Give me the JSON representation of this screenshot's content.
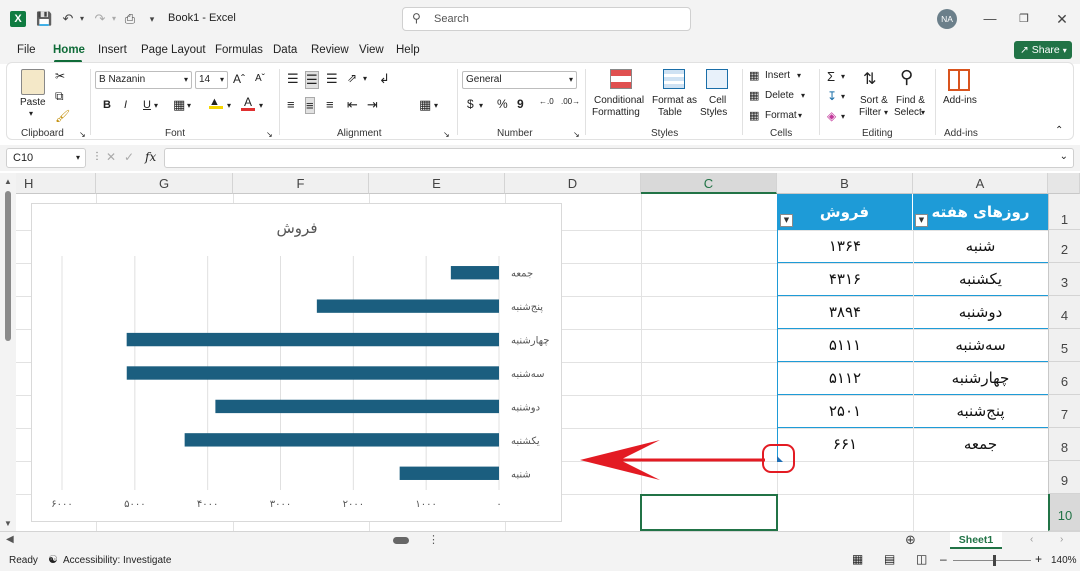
{
  "titlebar": {
    "book_title": "Book1 - Excel",
    "search_placeholder": "Search",
    "user_initials": "NA",
    "share_label": "Share"
  },
  "tabs": [
    "File",
    "Home",
    "Insert",
    "Page Layout",
    "Formulas",
    "Data",
    "Review",
    "View",
    "Help"
  ],
  "ribbon": {
    "clipboard": {
      "paste": "Paste",
      "label": "Clipboard"
    },
    "font": {
      "name": "B Nazanin",
      "size": "14",
      "label": "Font",
      "bold": "B",
      "italic": "I",
      "underline": "U"
    },
    "alignment": {
      "label": "Alignment"
    },
    "number": {
      "format": "General",
      "label": "Number",
      "currency": "$",
      "percent": "%",
      "comma": "9"
    },
    "styles": {
      "conditional": "Conditional",
      "formatting": "Formatting",
      "format_as": "Format as",
      "table": "Table",
      "cell": "Cell",
      "cell_styles": "Styles",
      "label": "Styles"
    },
    "cells": {
      "insert": "Insert",
      "delete": "Delete",
      "format": "Format",
      "label": "Cells"
    },
    "editing": {
      "sort": "Sort &",
      "filter": "Filter",
      "find": "Find &",
      "select": "Select",
      "label": "Editing"
    },
    "addins": {
      "button": "Add-ins",
      "label": "Add-ins"
    }
  },
  "formula_bar": {
    "name_box": "C10",
    "fx": "fx",
    "value": ""
  },
  "columns": [
    "H",
    "G",
    "F",
    "E",
    "D",
    "C",
    "B",
    "A"
  ],
  "rows": [
    "1",
    "2",
    "3",
    "4",
    "5",
    "6",
    "7",
    "8",
    "9",
    "10"
  ],
  "table": {
    "header_day": "روزهای هفته",
    "header_sales": "فروش",
    "rows": [
      {
        "day": "شنبه",
        "sales": "۱۳۶۴"
      },
      {
        "day": "یکشنبه",
        "sales": "۴۳۱۶"
      },
      {
        "day": "دوشنبه",
        "sales": "۳۸۹۴"
      },
      {
        "day": "سه‌شنبه",
        "sales": "۵۱۱۱"
      },
      {
        "day": "چهارشنبه",
        "sales": "۵۱۱۲"
      },
      {
        "day": "پنج‌شنبه",
        "sales": "۲۵۰۱"
      },
      {
        "day": "جمعه",
        "sales": "۶۶۱"
      }
    ]
  },
  "chart_data": {
    "type": "bar",
    "title": "فروش",
    "categories": [
      "شنبه",
      "یکشنبه",
      "دوشنبه",
      "سه‌شنبه",
      "چهارشنبه",
      "پنج‌شنبه",
      "جمعه"
    ],
    "values": [
      1364,
      4316,
      3894,
      5111,
      5112,
      2501,
      661
    ],
    "xlim": [
      0,
      6000
    ],
    "xticks": [
      "۰",
      "۱۰۰۰",
      "۲۰۰۰",
      "۳۰۰۰",
      "۴۰۰۰",
      "۵۰۰۰",
      "۶۰۰۰"
    ],
    "orientation": "horizontal, reversed axis (right-to-left)",
    "bar_color": "#1b5e7f",
    "grid": true
  },
  "annotation": {
    "arrow_color": "#e31b23",
    "circle_color": "#e31b23"
  },
  "sheet": {
    "tab": "Sheet1"
  },
  "status": {
    "ready": "Ready",
    "accessibility": "Accessibility: Investigate",
    "zoom": "140%"
  },
  "colors": {
    "accent_green": "#217346",
    "table_header": "#1e9bd7"
  }
}
